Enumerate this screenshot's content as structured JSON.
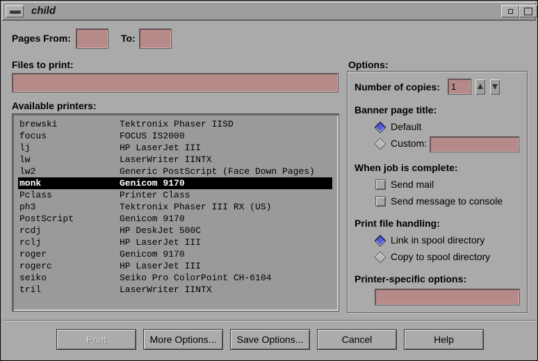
{
  "window": {
    "title": "child"
  },
  "pages": {
    "from_label": "Pages From:",
    "from_value": "",
    "to_label": "To:",
    "to_value": ""
  },
  "files": {
    "label": "Files to print:",
    "value": ""
  },
  "printers": {
    "label": "Available printers:",
    "selected": "monk",
    "rows": [
      {
        "name": "brewski",
        "desc": "Tektronix Phaser IISD"
      },
      {
        "name": "focus",
        "desc": "FOCUS IS2000"
      },
      {
        "name": "lj",
        "desc": "HP LaserJet III"
      },
      {
        "name": "lw",
        "desc": "LaserWriter IINTX"
      },
      {
        "name": "lw2",
        "desc": "Generic PostScript (Face Down Pages)"
      },
      {
        "name": "monk",
        "desc": "Genicom 9170"
      },
      {
        "name": "Pclass",
        "desc": "Printer Class"
      },
      {
        "name": "ph3",
        "desc": "Tektronix Phaser III RX (US)"
      },
      {
        "name": "PostScript",
        "desc": "Genicom 9170"
      },
      {
        "name": "rcdj",
        "desc": "HP DeskJet 500C"
      },
      {
        "name": "rclj",
        "desc": "HP LaserJet III"
      },
      {
        "name": "roger",
        "desc": "Genicom 9170"
      },
      {
        "name": "rogerc",
        "desc": "HP LaserJet III"
      },
      {
        "name": "seiko",
        "desc": "Seiko Pro ColorPoint CH-6104"
      },
      {
        "name": "tril",
        "desc": "LaserWriter IINTX"
      }
    ]
  },
  "options": {
    "label": "Options:",
    "copies_label": "Number of copies:",
    "copies_value": "1",
    "banner_label": "Banner page title:",
    "banner_default": "Default",
    "banner_custom": "Custom:",
    "banner_custom_value": "",
    "banner_selected": "default",
    "complete_label": "When job is complete:",
    "send_mail": "Send mail",
    "send_console": "Send message to console",
    "send_mail_checked": false,
    "send_console_checked": false,
    "handling_label": "Print file handling:",
    "handling_link": "Link in spool directory",
    "handling_copy": "Copy to spool directory",
    "handling_selected": "link",
    "specific_label": "Printer-specific options:",
    "specific_value": ""
  },
  "buttons": {
    "print": "Print",
    "more": "More Options...",
    "save": "Save Options...",
    "cancel": "Cancel",
    "help": "Help"
  },
  "colors": {
    "field": "#b78a8a",
    "radio_on": "#5b5bd6",
    "background": "#aaaaaa"
  }
}
